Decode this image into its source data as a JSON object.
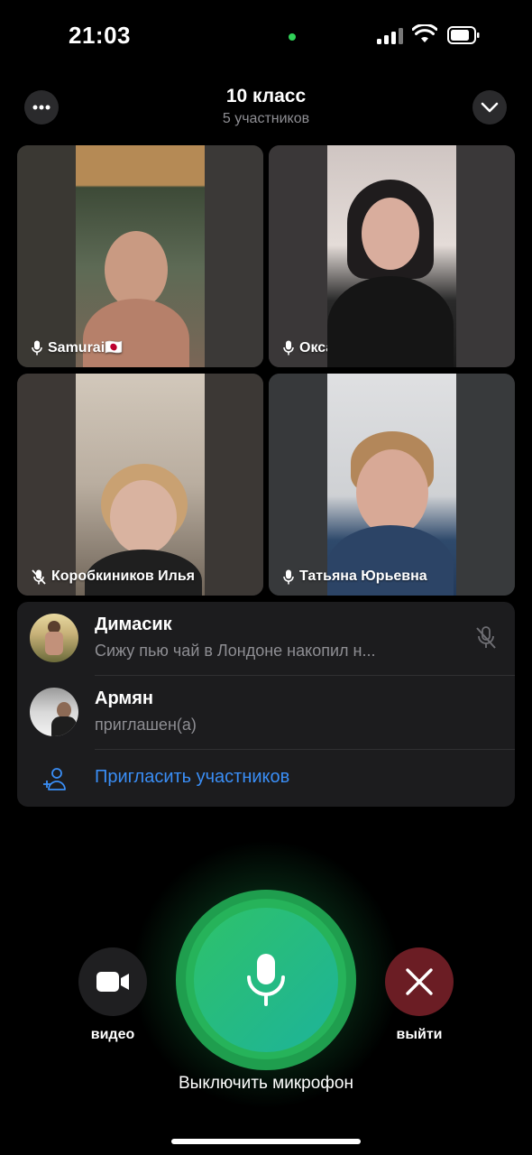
{
  "status_bar": {
    "time": "21:03"
  },
  "header": {
    "title": "10 класс",
    "subtitle": "5 участников",
    "more_icon": "ellipsis-icon",
    "collapse_icon": "chevron-down-icon"
  },
  "tiles": [
    {
      "name": "Samurai🇯🇵",
      "mic_muted": false
    },
    {
      "name": "Оксана😌",
      "mic_muted": false
    },
    {
      "name": "Коробкиников Илья",
      "mic_muted": true
    },
    {
      "name": "Татьяна Юрьевна",
      "mic_muted": false
    }
  ],
  "participants": [
    {
      "name": "Димасик",
      "status": "Сижу пью чай в Лондоне накопил н...",
      "mic_muted": true
    },
    {
      "name": "Армян",
      "status": "приглашен(а)"
    }
  ],
  "invite": {
    "label": "Пригласить участников",
    "icon": "add-user-icon"
  },
  "controls": {
    "video_label": "видео",
    "leave_label": "выйти",
    "mic_label": "Выключить микрофон"
  },
  "colors": {
    "accent_blue": "#3a8ef6",
    "mic_green": "#2ec26a",
    "leave_red": "#6b1d24",
    "panel": "#1c1c1e"
  }
}
